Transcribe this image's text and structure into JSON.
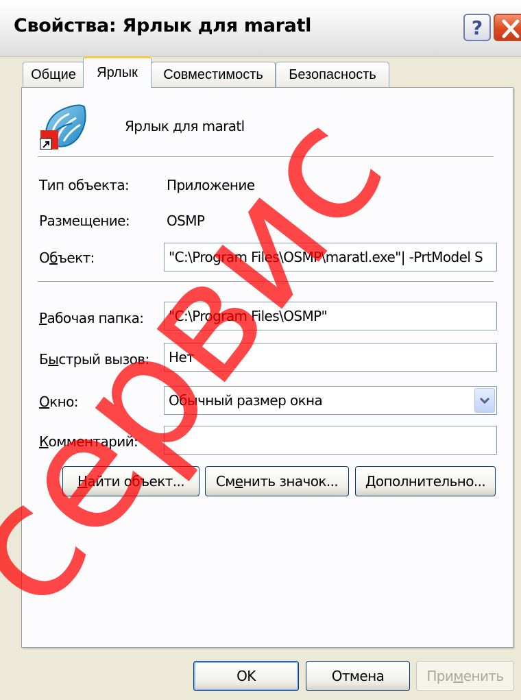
{
  "window": {
    "title": "Свойства: Ярлык для maratl",
    "help_label": "?"
  },
  "tabs": [
    {
      "label": "Общие",
      "active": false
    },
    {
      "label": "Ярлык",
      "active": true
    },
    {
      "label": "Совместимость",
      "active": false
    },
    {
      "label": "Безопасность",
      "active": false
    }
  ],
  "shortcut": {
    "name": "Ярлык для maratl",
    "object_type_label": "Тип объекта:",
    "object_type_value": "Приложение",
    "location_label": "Размещение:",
    "location_value": "OSMP",
    "target_label_pre": "О",
    "target_label_acc": "б",
    "target_label_post": "ъект:",
    "target_value": "\"C:\\Program Files\\OSMP\\maratl.exe\"| -PrtModel S",
    "workdir_label_acc": "Р",
    "workdir_label_post": "абочая папка:",
    "workdir_value": "\"C:\\Program Files\\OSMP\"",
    "hotkey_label_pre": "Б",
    "hotkey_label_acc": "ы",
    "hotkey_label_post": "стрый вызов:",
    "hotkey_value": "Нет",
    "window_label_acc": "О",
    "window_label_post": "кно:",
    "window_value": "Обычный размер окна",
    "comment_label_acc": "К",
    "comment_label_post": "омментарий:",
    "comment_value": ""
  },
  "buttons": {
    "find_acc": "Н",
    "find_post": "айти объект...",
    "change_pre": "См",
    "change_acc": "е",
    "change_post": "нить значок...",
    "advanced_acc": "Д",
    "advanced_post": "ополнительно...",
    "ok": "OK",
    "cancel": "Отмена",
    "apply_pre": "При",
    "apply_acc": "м",
    "apply_post": "енить"
  },
  "watermark_text": "сервис",
  "colors": {
    "dialog_bg": "#ece9d8",
    "panel_bg": "#fcfcfe",
    "active_tab_accent": "#ffc83c",
    "close_button": "#dd4a21",
    "field_border": "#7f9db9",
    "button_border": "#003c74",
    "watermark": "#ff0000"
  }
}
